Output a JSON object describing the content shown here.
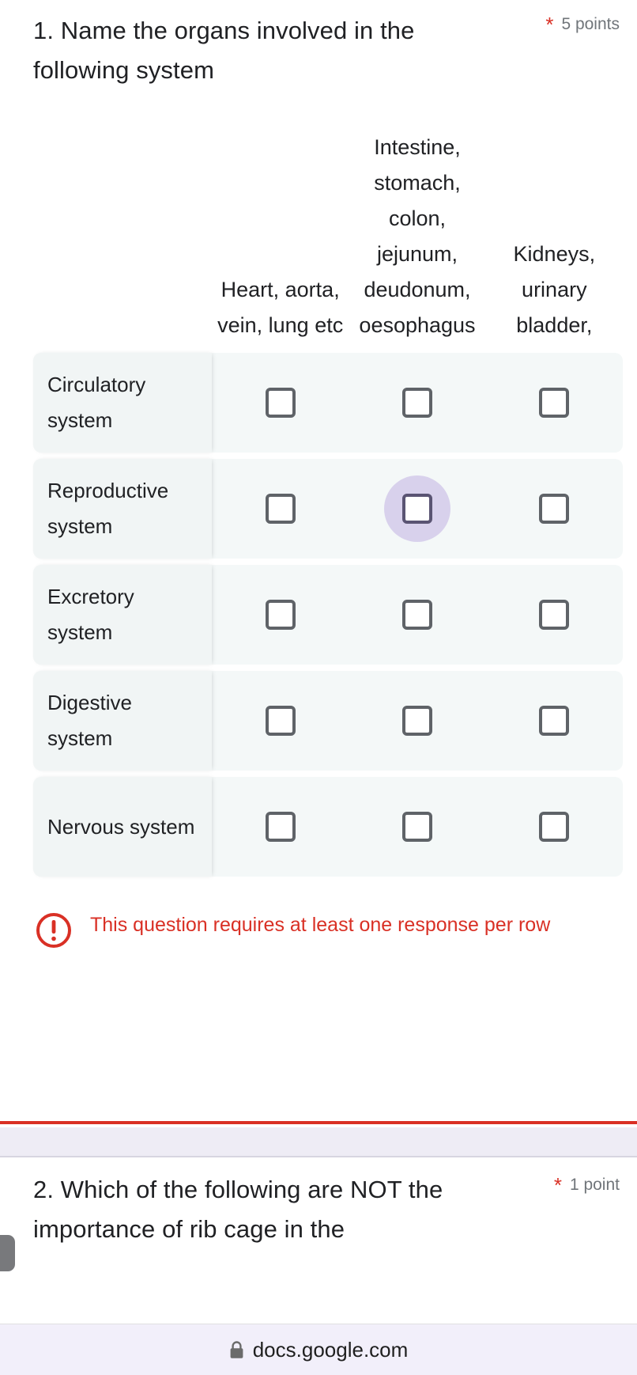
{
  "question1": {
    "title": "1. Name the organs involved in the following system",
    "required_marker": "*",
    "points": "5 points",
    "grid": {
      "columns": [
        "Heart, aorta, vein, lung etc",
        "Intestine, stomach, colon, jejunum, deudonum, oesophagus",
        "Kidneys, urinary bladder,"
      ],
      "rows": [
        {
          "label": "Circulatory system",
          "cells": [
            false,
            false,
            false
          ]
        },
        {
          "label": "Reproductive system",
          "cells": [
            false,
            false,
            false
          ],
          "focused_column": 1
        },
        {
          "label": "Excretory system",
          "cells": [
            false,
            false,
            false
          ]
        },
        {
          "label": "Digestive system",
          "cells": [
            false,
            false,
            false
          ]
        },
        {
          "label": "Nervous system",
          "cells": [
            false,
            false,
            false
          ]
        }
      ]
    },
    "error": {
      "icon": "error-exclamation-icon",
      "message": "This question requires at least one response per row"
    }
  },
  "question2": {
    "title": "2.  Which of the following are NOT the importance of rib cage in the",
    "required_marker": "*",
    "points": "1 point"
  },
  "browser": {
    "lock_icon": "lock-icon",
    "url": "docs.google.com"
  },
  "colors": {
    "error_red": "#d93025",
    "row_label_bg": "#f1f5f5",
    "row_cell_bg": "#f4f8f8",
    "checkbox_border": "#5f6368",
    "ripple_purple": "#cfc4e8",
    "gap_band": "#eeecf5",
    "url_bar_bg": "#f2effa"
  }
}
